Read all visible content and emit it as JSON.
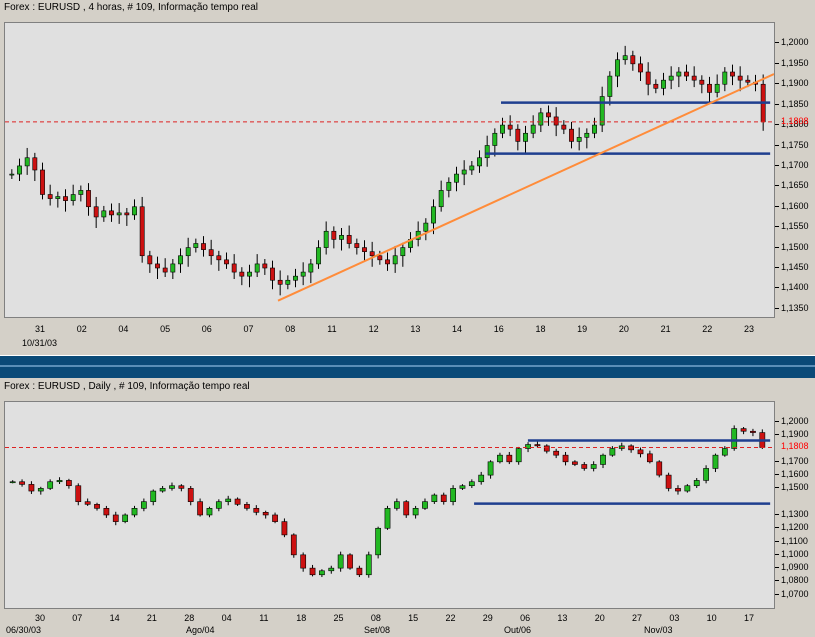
{
  "colors": {
    "up": "#22b822",
    "down": "#cc1111",
    "support": "#1f3f8f",
    "trend": "#ff8c3a",
    "price_line": "#dd2222",
    "plot_bg": "#e0e0e0"
  },
  "top": {
    "title": "Forex : EURUSD , 4 horas, # 109, Informação tempo real",
    "ylim": [
      1.133,
      1.205
    ],
    "yticks": [
      "1,2000",
      "1,1950",
      "1,1900",
      "1,1850",
      "1,1800",
      "1,1750",
      "1,1700",
      "1,1650",
      "1,1600",
      "1,1550",
      "1,1500",
      "1,1450",
      "1,1400",
      "1,1350"
    ],
    "price_label": "1,1808",
    "price": 1.1808,
    "xticks": [
      "31",
      "02",
      "04",
      "05",
      "06",
      "07",
      "08",
      "11",
      "12",
      "13",
      "14",
      "16",
      "18",
      "19",
      "20",
      "21",
      "22",
      "23"
    ],
    "date_label": "10/31/03",
    "support_lines": [
      {
        "y": 1.1855
      },
      {
        "y": 1.173
      }
    ],
    "trend_line": {
      "start": 1.137,
      "end": 1.1925
    }
  },
  "bottom": {
    "title": "Forex : EURUSD , Daily , # 109, Informação tempo real",
    "ylim": [
      1.06,
      1.215
    ],
    "yticks": [
      "1,2000",
      "1,1900",
      "1,1700",
      "1,1600",
      "1,1500",
      "1,1300",
      "1,1200",
      "1,1100",
      "1,1000",
      "1,0900",
      "1,0800",
      "1,0700"
    ],
    "price_label": "1,1808",
    "price": 1.1808,
    "xticks": [
      "30",
      "07",
      "14",
      "21",
      "28",
      "04",
      "11",
      "18",
      "25",
      "08",
      "15",
      "22",
      "29",
      "06",
      "13",
      "20",
      "27",
      "03",
      "10",
      "17"
    ],
    "date_labels": [
      "06/30/03",
      "Ago/04",
      "Set/08",
      "Out/06",
      "Nov/03"
    ],
    "support_lines": [
      {
        "y": 1.186
      },
      {
        "y": 1.1385
      }
    ]
  },
  "chart_data": [
    {
      "type": "candlestick",
      "title": "Forex : EURUSD , 4 horas, # 109, Informação tempo real",
      "ylim": [
        1.133,
        1.205
      ],
      "close_series": [
        1.168,
        1.17,
        1.172,
        1.169,
        1.163,
        1.162,
        1.1625,
        1.1615,
        1.163,
        1.164,
        1.16,
        1.1575,
        1.159,
        1.158,
        1.1585,
        1.158,
        1.16,
        1.148,
        1.146,
        1.145,
        1.144,
        1.146,
        1.148,
        1.15,
        1.151,
        1.1495,
        1.148,
        1.147,
        1.146,
        1.144,
        1.143,
        1.144,
        1.146,
        1.145,
        1.142,
        1.141,
        1.142,
        1.143,
        1.144,
        1.146,
        1.15,
        1.154,
        1.152,
        1.153,
        1.151,
        1.15,
        1.149,
        1.148,
        1.147,
        1.146,
        1.148,
        1.15,
        1.152,
        1.154,
        1.156,
        1.16,
        1.164,
        1.166,
        1.168,
        1.169,
        1.17,
        1.172,
        1.175,
        1.178,
        1.18,
        1.179,
        1.176,
        1.178,
        1.18,
        1.183,
        1.182,
        1.18,
        1.179,
        1.176,
        1.177,
        1.178,
        1.18,
        1.187,
        1.192,
        1.196,
        1.197,
        1.195,
        1.193,
        1.19,
        1.189,
        1.191,
        1.192,
        1.193,
        1.192,
        1.191,
        1.19,
        1.188,
        1.19,
        1.193,
        1.192,
        1.191,
        1.1905,
        1.19,
        1.1808
      ]
    },
    {
      "type": "candlestick",
      "title": "Forex : EURUSD , Daily , # 109, Informação tempo real",
      "ylim": [
        1.06,
        1.215
      ],
      "close_series": [
        1.155,
        1.153,
        1.148,
        1.15,
        1.155,
        1.156,
        1.152,
        1.14,
        1.138,
        1.135,
        1.13,
        1.125,
        1.13,
        1.135,
        1.14,
        1.148,
        1.15,
        1.152,
        1.15,
        1.14,
        1.13,
        1.135,
        1.14,
        1.142,
        1.138,
        1.135,
        1.132,
        1.13,
        1.125,
        1.115,
        1.1,
        1.09,
        1.085,
        1.088,
        1.09,
        1.1,
        1.09,
        1.085,
        1.1,
        1.12,
        1.135,
        1.14,
        1.13,
        1.135,
        1.14,
        1.145,
        1.14,
        1.15,
        1.152,
        1.155,
        1.16,
        1.17,
        1.175,
        1.17,
        1.18,
        1.183,
        1.182,
        1.178,
        1.175,
        1.17,
        1.168,
        1.165,
        1.168,
        1.175,
        1.18,
        1.182,
        1.179,
        1.176,
        1.17,
        1.16,
        1.15,
        1.148,
        1.152,
        1.156,
        1.165,
        1.175,
        1.18,
        1.195,
        1.193,
        1.192,
        1.1808
      ]
    }
  ]
}
